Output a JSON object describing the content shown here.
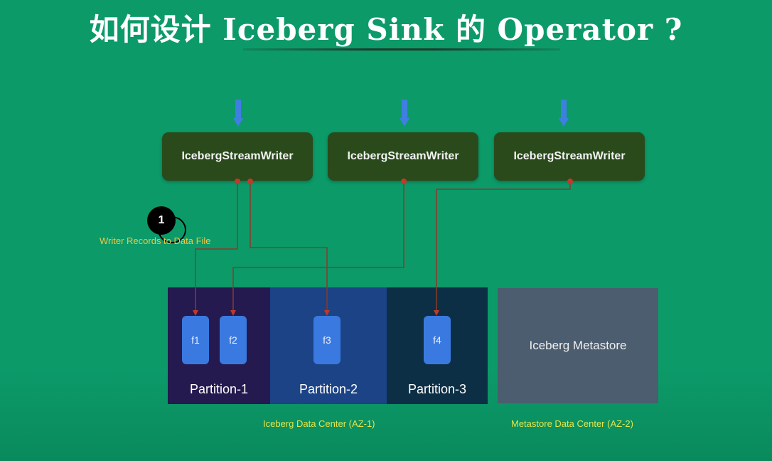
{
  "title": "如何设计 Iceberg Sink 的 Operator ?",
  "writers": [
    {
      "label": "IcebergStreamWriter"
    },
    {
      "label": "IcebergStreamWriter"
    },
    {
      "label": "IcebergStreamWriter"
    }
  ],
  "step": {
    "number": "1",
    "note": "Writer Records to Data File"
  },
  "partitions": [
    {
      "label": "Partition-1",
      "color": "#241a4f"
    },
    {
      "label": "Partition-2",
      "color": "#1c4386"
    },
    {
      "label": "Partition-3",
      "color": "#0d2f45"
    }
  ],
  "files": [
    "f1",
    "f2",
    "f3",
    "f4"
  ],
  "metastore": {
    "label": "Iceberg Metastore"
  },
  "captions": {
    "data_center": "Iceberg Data Center (AZ-1)",
    "metastore_center": "Metastore Data Center (AZ-2)"
  },
  "colors": {
    "wire": "#8a3b2a",
    "dot": "#c0392b",
    "input_arrow": "#3f7fe0"
  }
}
